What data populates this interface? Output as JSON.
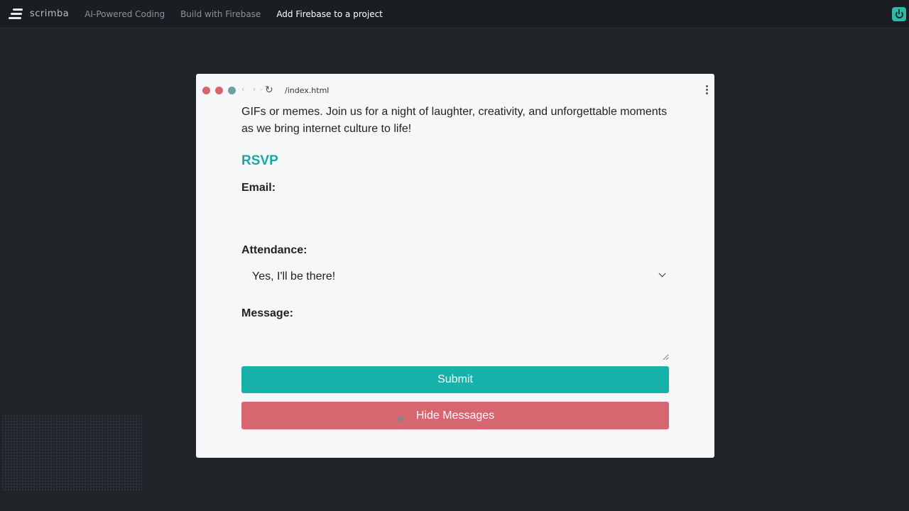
{
  "topbar": {
    "logo_text": "scrimba",
    "breadcrumbs": [
      "AI-Powered Coding",
      "Build with Firebase",
      "Add Firebase to a project"
    ]
  },
  "browser": {
    "url": "/index.html",
    "nav_back": "‹",
    "nav_forward": "› - ·",
    "reload_icon": "↻"
  },
  "page": {
    "intro_text": "GIFs or memes. Join us for a night of laughter, creativity, and unforgettable moments as we bring internet culture to life!",
    "rsvp_title": "RSVP",
    "email_label": "Email:",
    "email_value": "",
    "attendance_label": "Attendance:",
    "attendance_selected": "Yes, I'll be there!",
    "message_label": "Message:",
    "message_value": "",
    "submit_label": "Submit",
    "hide_messages_label": "Hide Messages"
  },
  "colors": {
    "accent_teal": "#16b2a9",
    "rsvp_teal": "#1aa7a4",
    "hide_button_red": "#d66670",
    "background_dark": "#202429"
  },
  "icons": [
    "scrimba-logo-icon",
    "power-icon",
    "reload-icon",
    "kebab-menu-icon",
    "chevron-down-icon",
    "mouse-cursor-icon"
  ]
}
